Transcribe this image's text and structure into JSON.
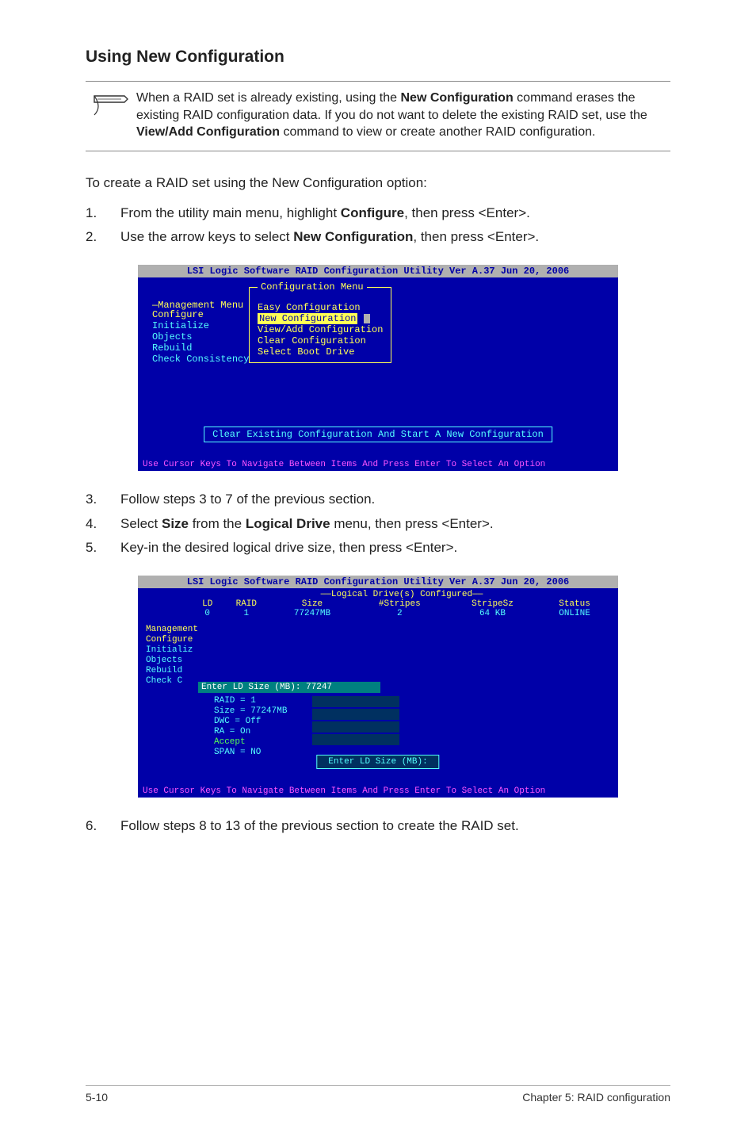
{
  "section_title": "Using New Configuration",
  "note": {
    "t1": "When a RAID set is already existing, using the ",
    "b1": "New Configuration",
    "t2": " command erases the existing RAID configuration data. If you do not want to delete the existing RAID set, use the ",
    "b2": "View/Add Configuration",
    "t3": " command to view or create another RAID configuration."
  },
  "intro": "To create a RAID set using the New Configuration option:",
  "steps_a": [
    {
      "n": "1.",
      "pre": "From the utility main menu, highlight ",
      "b": "Configure",
      "post": ", then press <Enter>."
    },
    {
      "n": "2.",
      "pre": "Use the arrow keys to select ",
      "b": "New Configuration",
      "post": ", then press <Enter>."
    }
  ],
  "bios1": {
    "title": "LSI Logic Software RAID Configuration Utility Ver A.37 Jun 20, 2006",
    "mgmt_label": "Management Menu",
    "mgmt_items": [
      "Configure",
      "Initialize",
      "Objects",
      "Rebuild",
      "Check Consistency"
    ],
    "conf_title": "Configuration Menu",
    "conf_items": [
      "Easy Configuration",
      "New Configuration",
      "View/Add Configuration",
      "Clear Configuration",
      "Select Boot Drive"
    ],
    "conf_selected_index": 1,
    "msg": "Clear Existing Configuration And Start A New Configuration",
    "footer": "Use Cursor Keys To Navigate Between Items And Press Enter To Select An Option"
  },
  "steps_b": [
    {
      "n": "3.",
      "text": "Follow steps 3 to 7 of the previous section."
    },
    {
      "n": "4.",
      "pre": "Select ",
      "b1": "Size",
      "mid": " from the ",
      "b2": "Logical Drive",
      "post": " menu, then press <Enter>."
    },
    {
      "n": "5.",
      "text": "Key-in the desired logical drive size, then press <Enter>."
    }
  ],
  "bios2": {
    "title": "LSI Logic Software RAID Configuration Utility Ver A.37 Jun 20, 2006",
    "subtitle": "Logical Drive(s) Configured",
    "headers": [
      "LD",
      "RAID",
      "Size",
      "#Stripes",
      "StripeSz",
      "Status"
    ],
    "row": {
      "ld": "0",
      "raid": "1",
      "size": "77247MB",
      "stripes": "2",
      "stripesz": "64  KB",
      "status": "ONLINE"
    },
    "left_label": "Management",
    "left_items": [
      "Configure",
      "Initializ",
      "Objects",
      "Rebuild",
      "Check C"
    ],
    "input_label": "Enter LD Size (MB): 77247",
    "params": [
      "RAID = 1",
      "Size = 77247MB",
      "DWC  = Off",
      "RA   = On",
      "Accept",
      "SPAN = NO"
    ],
    "enter_box": "Enter LD Size (MB):",
    "footer": "Use Cursor Keys To Navigate Between Items And Press Enter To Select An Option"
  },
  "steps_c": [
    {
      "n": "6.",
      "text": "Follow steps 8 to 13 of the previous section to create the RAID set."
    }
  ],
  "footer": {
    "left": "5-10",
    "right": "Chapter 5: RAID configuration"
  }
}
